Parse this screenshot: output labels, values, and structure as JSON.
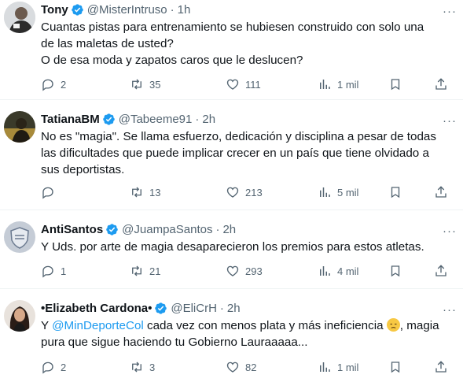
{
  "tweets": [
    {
      "name": "Tony",
      "handle": "@MisterIntruso",
      "time": "1h",
      "text_lines": [
        "Cuantas pistas para entrenamiento se hubiesen construido con solo una",
        "de las maletas de usted?",
        "O de esa moda y zapatos caros que le deslucen?"
      ],
      "replies": "2",
      "retweets": "35",
      "likes": "111",
      "views": "1 mil"
    },
    {
      "name": "TatianaBM",
      "handle": "@Tabeeme91",
      "time": "2h",
      "text_lines": [
        "No es \"magia\". Se llama esfuerzo, dedicación y disciplina a pesar de todas",
        "las dificultades que puede implicar crecer en un país que tiene olvidado a",
        "sus deportistas."
      ],
      "replies": "",
      "retweets": "13",
      "likes": "213",
      "views": "5 mil"
    },
    {
      "name": "AntiSantos",
      "handle": "@JuampaSantos",
      "time": "2h",
      "text_lines": [
        "Y Uds. por arte de magia desaparecieron los premios para estos atletas."
      ],
      "replies": "1",
      "retweets": "21",
      "likes": "293",
      "views": "4 mil"
    },
    {
      "name": "•Elizabeth Cardona•",
      "handle": "@EliCrH",
      "time": "2h",
      "text_pre": "Y ",
      "mention": "@MinDeporteCol",
      "text_mid": " cada vez con menos plata y más ineficiencia ",
      "text_post": ", magia",
      "text_line2": "pura que sigue haciendo tu Gobierno Lauraaaaa...",
      "replies": "2",
      "retweets": "3",
      "likes": "82",
      "views": "1 mil"
    }
  ],
  "dot": "·",
  "more": "···",
  "colors": {
    "accent": "#1d9bf0",
    "muted": "#536471",
    "text": "#0f1419"
  }
}
